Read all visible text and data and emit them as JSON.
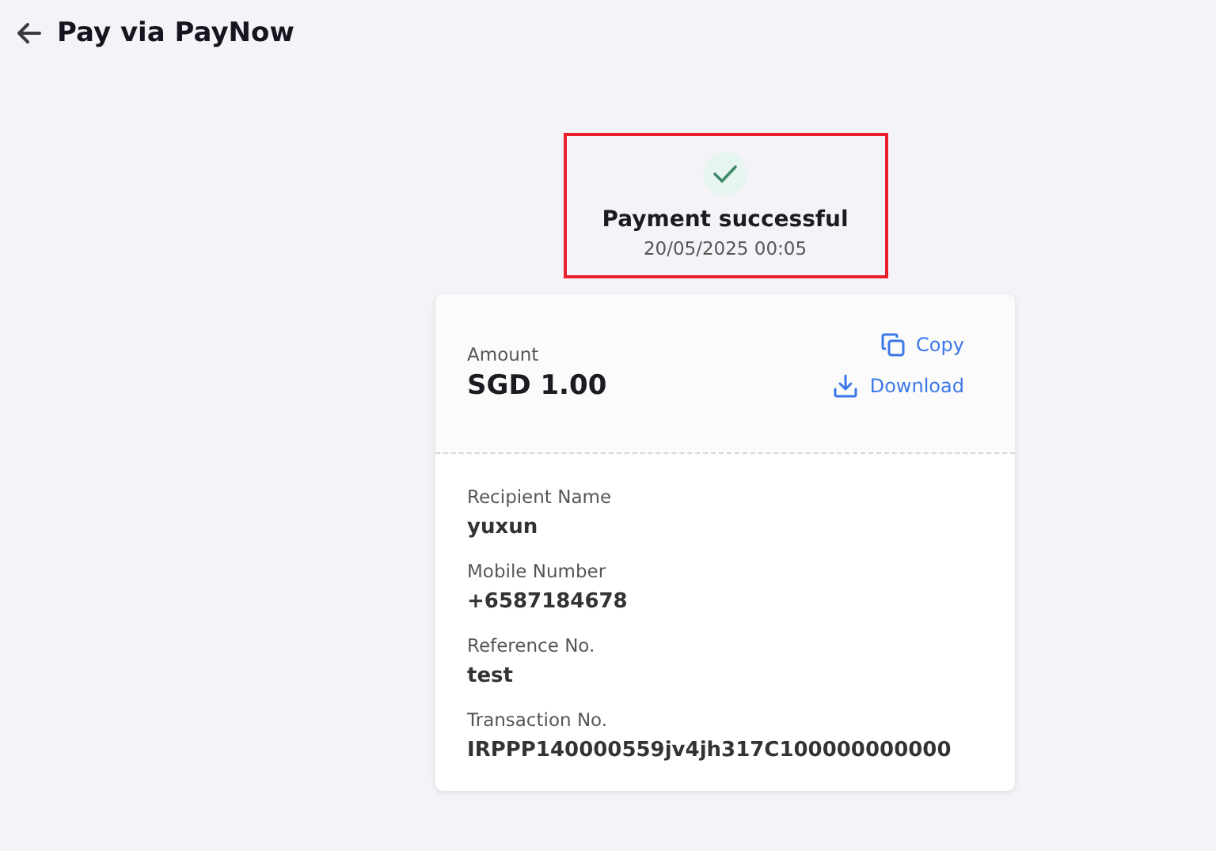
{
  "header": {
    "title": "Pay via PayNow"
  },
  "status": {
    "highlighted": true,
    "title": "Payment successful",
    "datetime": "20/05/2025 00:05"
  },
  "summary": {
    "label": "Amount",
    "value": "SGD 1.00",
    "actions": [
      {
        "kind": "copy",
        "label": "Copy"
      },
      {
        "kind": "download",
        "label": "Download"
      }
    ]
  },
  "details": [
    {
      "label": "Recipient Name",
      "value": "yuxun"
    },
    {
      "label": "Mobile Number",
      "value": "+6587184678"
    },
    {
      "label": "Reference No.",
      "value": "test"
    },
    {
      "label": "Transaction No.",
      "value": "IRPPP140000559jv4jh317C100000000000"
    }
  ]
}
